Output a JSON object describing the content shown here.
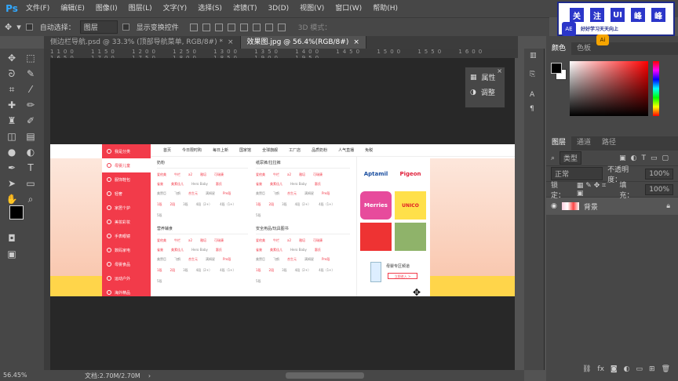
{
  "app": {
    "logo": "Ps"
  },
  "menu": [
    "文件(F)",
    "编辑(E)",
    "图像(I)",
    "图层(L)",
    "文字(Y)",
    "选择(S)",
    "滤镜(T)",
    "3D(D)",
    "视图(V)",
    "窗口(W)",
    "帮助(H)"
  ],
  "options": {
    "auto_select_label": "自动选择：",
    "auto_select_value": "图层",
    "show_transform": "显示变换控件",
    "mode3d": "3D 模式："
  },
  "tabs": [
    {
      "label": "侧边栏导航.psd @ 33.3% (顶部导航菜单, RGB/8#) *",
      "close": "×"
    },
    {
      "label": "效果图.jpg @ 56.4%(RGB/8#)",
      "close": "×"
    }
  ],
  "ruler_h": "1100 1150 1200 1250 1300 1350 1400 1450 1500 1550 1600 1650 1700 1750 1800 1850 1900 1950",
  "web": {
    "sidebar": [
      "我是分类",
      "母婴儿童",
      "服饰鞋包",
      "轻奢",
      "家居个护",
      "美妆彩妆",
      "手表眼镜",
      "数码家电",
      "母婴食品",
      "运动户外",
      "海外精品"
    ],
    "topnav": [
      "首页",
      "今日限时购",
      "每日上新",
      "国家馆",
      "全球旗舰",
      "工厂店",
      "品质奶粉",
      "人气直播",
      "免税"
    ],
    "cat1": "奶粉",
    "cat2": "纸尿裤/拉拉裤",
    "cat3": "营养辅食",
    "cat4": "安全用品/玩具图书",
    "row_a": [
      "爱他美",
      "牛栏",
      "a2",
      "雅培",
      "可瑞康"
    ],
    "row_b": [
      "雀巢",
      "美素佳儿",
      "Hero Baby",
      "惠氏"
    ],
    "row_c": [
      "美赞臣",
      "飞鹤",
      "合生元",
      "满姆星",
      "Pre段"
    ],
    "row_d": [
      "1段",
      "2段",
      "3段",
      "4段（2+）",
      "4段（1+）"
    ],
    "row_e": [
      "5段"
    ],
    "brands": [
      "Aptamil",
      "Pigeon",
      "Merries",
      "UNICO",
      "",
      ""
    ],
    "promo_title": "母婴专区频道",
    "promo_btn": "立即进入 >"
  },
  "mini_panel": {
    "props": "属性",
    "adjust": "调整",
    "close": "×"
  },
  "right_panel": {
    "color_tabs": [
      "颜色",
      "色板"
    ],
    "layer_tabs": [
      "图层",
      "通道",
      "路径"
    ],
    "kind": "类型",
    "blend": "正常",
    "opacity_label": "不透明度：",
    "opacity": "100%",
    "lock_label": "锁定：",
    "fill_label": "填充：",
    "fill": "100%",
    "layer_name": "背景"
  },
  "status": {
    "zoom": "56.45%",
    "doc": "文档:2.70M/2.70M"
  },
  "watermark": {
    "chars": [
      "关",
      "注",
      "UI",
      "峰",
      "峰"
    ],
    "sub": "好好学习天天向上",
    "ae": "AE",
    "ai": "Ai"
  }
}
